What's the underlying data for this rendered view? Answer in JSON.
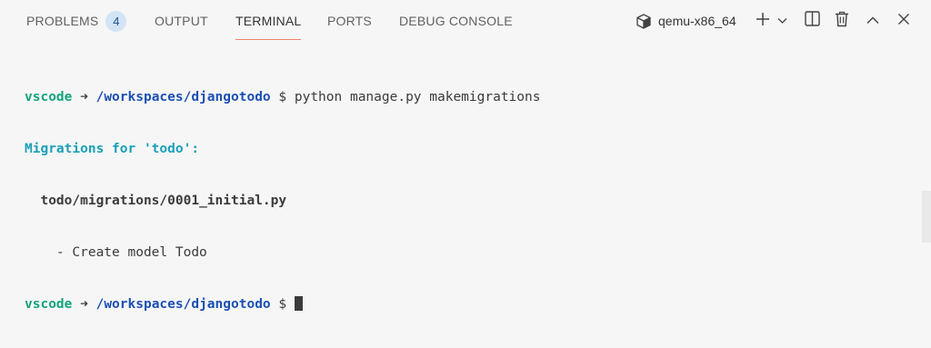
{
  "tabs": {
    "problems": {
      "label": "PROBLEMS",
      "count": "4"
    },
    "output": {
      "label": "OUTPUT"
    },
    "terminal": {
      "label": "TERMINAL"
    },
    "ports": {
      "label": "PORTS"
    },
    "debug_console": {
      "label": "DEBUG CONSOLE"
    }
  },
  "terminal_instance": {
    "name": "qemu-x86_64",
    "icon": "cube-icon"
  },
  "toolbar_icons": [
    "cube-icon",
    "plus-icon",
    "chevron-down-icon",
    "split-icon",
    "trash-icon",
    "chevron-up-icon",
    "close-icon"
  ],
  "terminal_lines": {
    "line1": {
      "user": "vscode",
      "arrow": "➜",
      "path": "/workspaces/djangotodo",
      "prompt": "$",
      "command": "python manage.py makemigrations"
    },
    "line2": {
      "text": "Migrations for 'todo':"
    },
    "line3": {
      "text": "todo/migrations/0001_initial.py"
    },
    "line4": {
      "text": "- Create model Todo"
    },
    "line5": {
      "user": "vscode",
      "arrow": "➜",
      "path": "/workspaces/djangotodo",
      "prompt": "$"
    }
  },
  "colors": {
    "active_tab_underline": "#f1806b",
    "badge_bg": "#d2e4f6",
    "prompt_user": "#12a37d",
    "prompt_path": "#1c50b3",
    "heading": "#1aa0b8"
  }
}
